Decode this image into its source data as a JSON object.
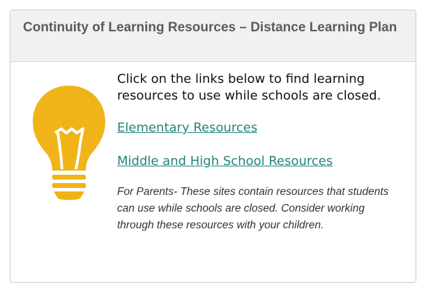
{
  "header": {
    "title": "Continuity of Learning Resources – Distance Learning Plan"
  },
  "body": {
    "intro": "Click on the links below to find learning resources to use while schools are closed.",
    "links": [
      {
        "label": "Elementary Resources"
      },
      {
        "label": "Middle and High School Resources"
      }
    ],
    "note": "For Parents- These sites contain resources that students can use while schools are closed. Consider working through these resources with your children."
  },
  "icon": {
    "name": "lightbulb-icon",
    "color": "#F0B418",
    "detail_color": "#FFFFFF"
  },
  "colors": {
    "link": "#22847A",
    "header_bg": "#F1F1F1",
    "title": "#5B5B5B"
  }
}
